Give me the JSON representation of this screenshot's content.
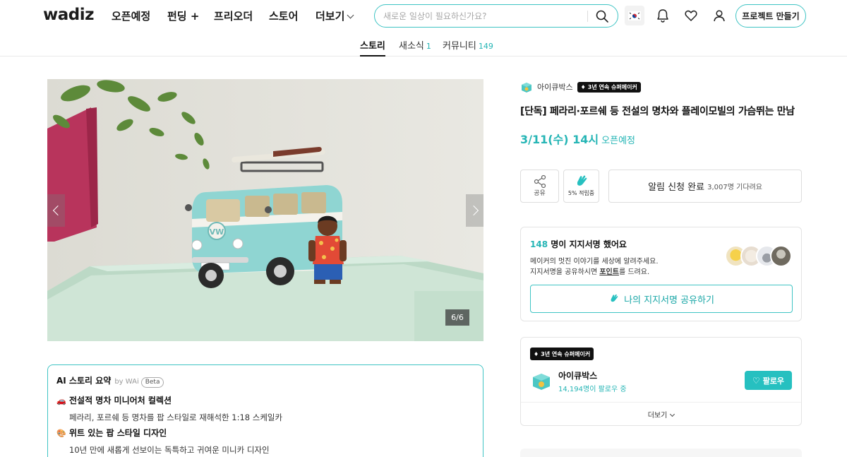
{
  "header": {
    "logo": "wadiz",
    "nav": [
      {
        "label": "오픈예정"
      },
      {
        "label": "펀딩 +"
      },
      {
        "label": "프리오더"
      },
      {
        "label": "스토어"
      },
      {
        "label": "더보기"
      }
    ],
    "search_placeholder": "새로운 일상이 필요하신가요?",
    "language_flag": "🇰🇷",
    "icons": [
      "search-icon",
      "bell-icon",
      "heart-icon",
      "user-icon"
    ],
    "make_project_label": "프로젝트 만들기"
  },
  "tabs": [
    {
      "label": "스토리",
      "count": "",
      "active": true
    },
    {
      "label": "새소식",
      "count": "1",
      "active": false
    },
    {
      "label": "커뮤니티",
      "count": "149",
      "active": false
    }
  ],
  "gallery": {
    "counter": "6/6"
  },
  "ai_summary": {
    "title": "AI 스토리 요약",
    "by": "by WAi",
    "beta": "Beta",
    "items": [
      {
        "emoji": "🚗",
        "heading": "전설적 명차 미니어처 컬렉션",
        "desc": "페라리, 포르쉐 등 명차를 팝 스타일로 재해석한 1:18 스케일카"
      },
      {
        "emoji": "🎨",
        "heading": "위트 있는 팝 스타일 디자인",
        "desc": "10년 만에 새롭게 선보이는 독특하고 귀여운 미니카 디자인"
      }
    ]
  },
  "project": {
    "maker_name": "아이큐박스",
    "maker_badge": "3년 연속 슈퍼메이커",
    "title": "[단독] 페라리·포르쉐 등 전설의 명차와 플레이모빌의 가슴뛰는 만남",
    "open_date": "3/11(수) 14시",
    "open_status": "오픈예정",
    "share_label": "공유",
    "point_label": "5% 적립중",
    "alarm_main": "알림 신청 완료",
    "alarm_count": "3,007명 기다려요"
  },
  "support": {
    "count": "148",
    "title_rest": " 명이 지지서명 했어요",
    "desc1": "메이커의 멋진 이야기를 세상에 알려주세요.",
    "desc2_pre": "지지서명을 공유하시면 ",
    "desc2_bold": "포인트",
    "desc2_post": "를 드려요.",
    "share_button": "나의 지지서명 공유하기"
  },
  "maker_card": {
    "badge": "3년 연속 슈퍼메이커",
    "name": "아이큐박스",
    "followers": "14,194명이 팔로우 중",
    "follow_label": "팔로우",
    "more_label": "더보기"
  },
  "colors": {
    "accent": "#25b5b5",
    "accent_border": "#3fc4c4",
    "follow_bg": "#26c0c0",
    "dark_badge": "#111111"
  }
}
